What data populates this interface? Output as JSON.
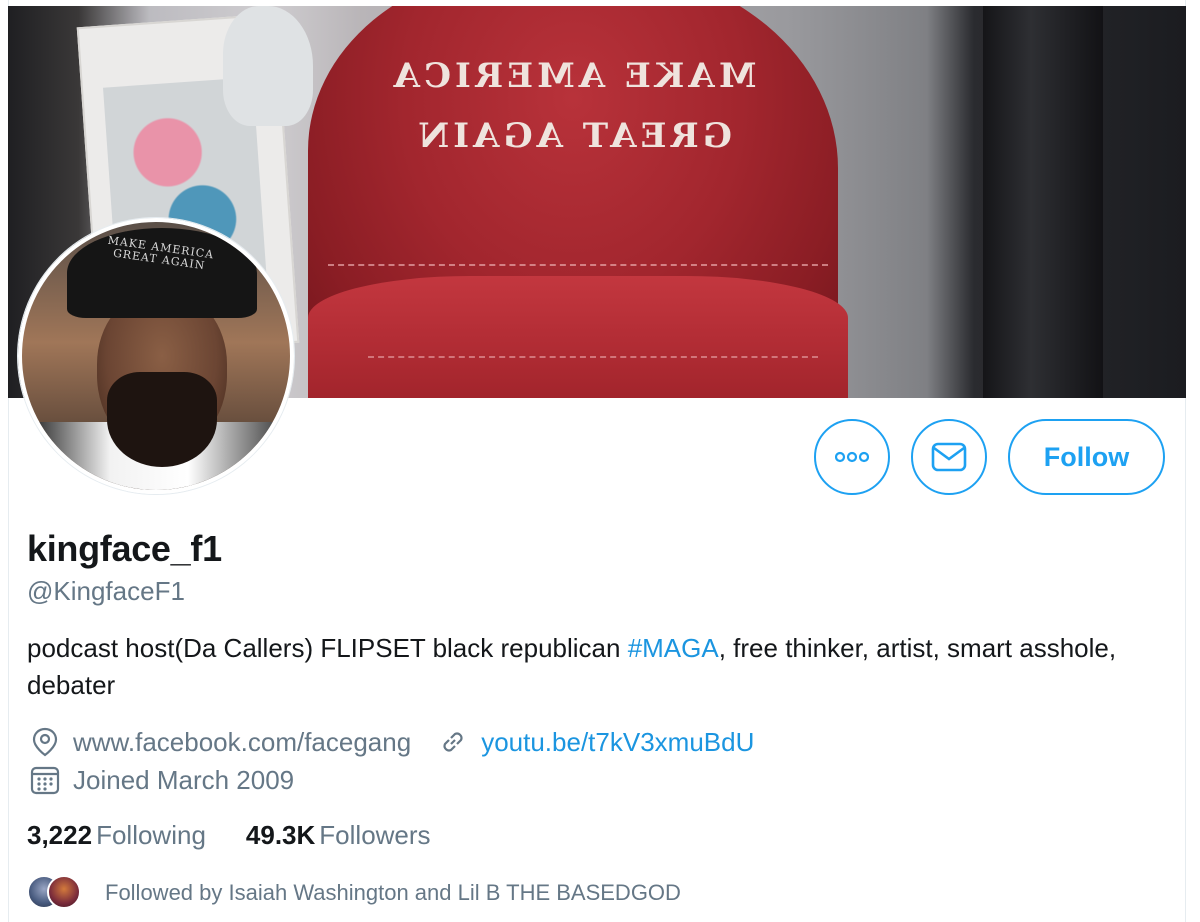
{
  "banner": {
    "hat_text_line1": "MAKE AMERICA",
    "hat_text_line2": "GREAT AGAIN"
  },
  "avatar": {
    "cap_text": "MAKE AMERICA GREAT AGAIN"
  },
  "actions": {
    "more_icon": "more-horizontal-icon",
    "message_icon": "envelope-icon",
    "follow_label": "Follow"
  },
  "profile": {
    "display_name": "kingface_f1",
    "handle": "@KingfaceF1",
    "bio_prefix": "podcast host(Da Callers) FLIPSET black republican ",
    "bio_hashtag": "#MAGA",
    "bio_suffix": ", free thinker, artist, smart asshole, debater",
    "location": "www.facebook.com/facegang",
    "website": "youtu.be/t7kV3xmuBdU",
    "joined": "Joined March 2009"
  },
  "stats": {
    "following_count": "3,222",
    "following_label": "Following",
    "followers_count": "49.3K",
    "followers_label": "Followers"
  },
  "followed_by": {
    "text": "Followed by Isaiah Washington and Lil B THE BASEDGOD"
  },
  "colors": {
    "accent": "#1da1f2",
    "link": "#1b95e0",
    "secondary_text": "#657786",
    "primary_text": "#14171a"
  }
}
